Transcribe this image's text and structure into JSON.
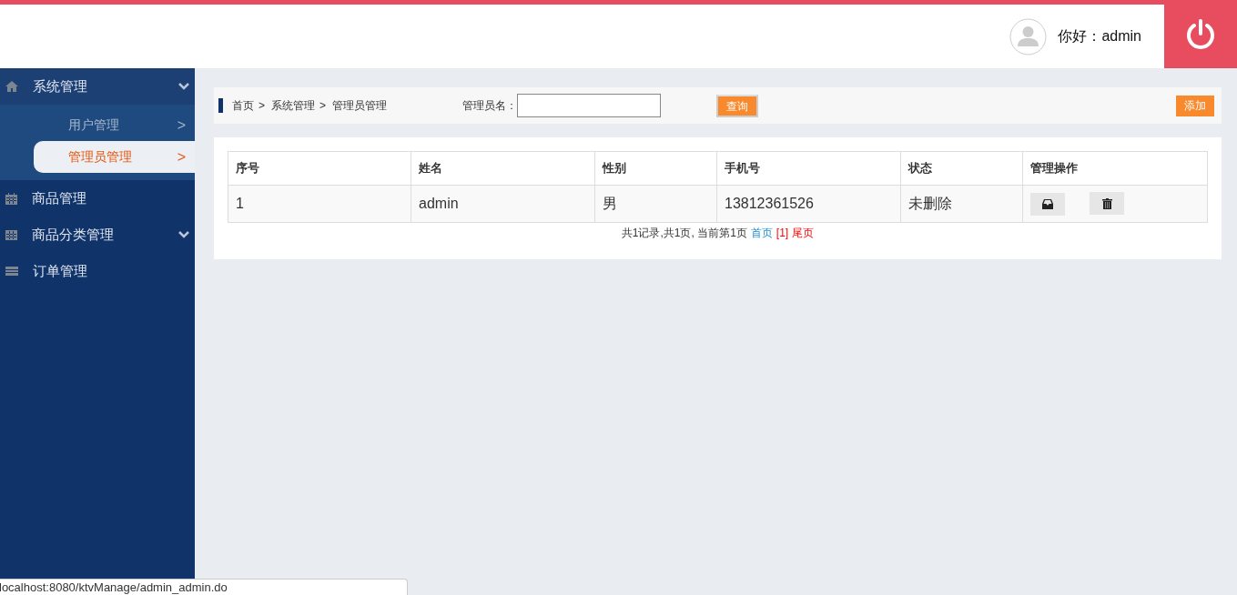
{
  "header": {
    "greeting": "你好：admin"
  },
  "sidebar": {
    "items": [
      {
        "label": "系统管理",
        "expanded": true,
        "has_children": true,
        "children": [
          {
            "label": "用户管理",
            "arrow": ">",
            "selected": false
          },
          {
            "label": "管理员管理",
            "arrow": ">",
            "selected": true
          }
        ]
      },
      {
        "label": "商品管理",
        "expanded": false,
        "has_children": false
      },
      {
        "label": "商品分类管理",
        "expanded": false,
        "has_children": true
      },
      {
        "label": "订单管理",
        "expanded": false,
        "has_children": false
      }
    ]
  },
  "breadcrumb": [
    "首页",
    "系统管理",
    "管理员管理"
  ],
  "breadcrumb_separator": ">",
  "search": {
    "label": "管理员名：",
    "button": "查询"
  },
  "add_button": "添加",
  "table": {
    "columns": [
      "序号",
      "姓名",
      "性别",
      "手机号",
      "状态",
      "管理操作"
    ],
    "rows": [
      {
        "cells": [
          "1",
          "admin",
          "男",
          "13812361526",
          "未删除"
        ]
      }
    ]
  },
  "pagination": {
    "summary": "共1记录,共1页, 当前第1页",
    "first": "首页",
    "current": "[1]",
    "last": "尾页"
  },
  "status_url": "localhost:8080/ktvManage/admin_admin.do"
}
